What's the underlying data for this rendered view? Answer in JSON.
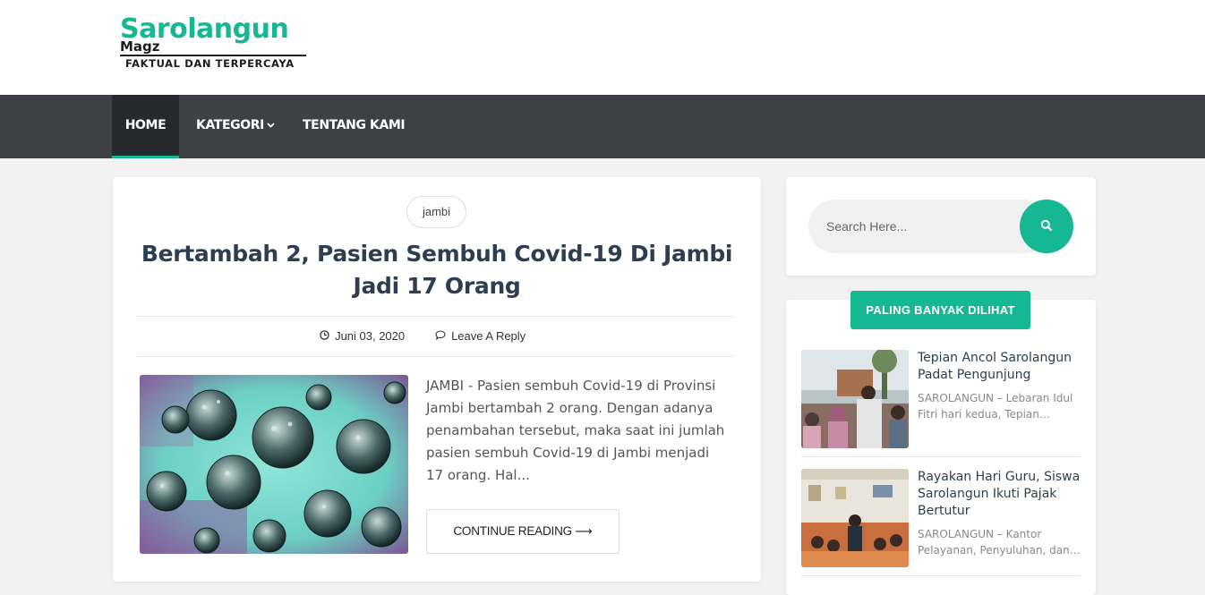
{
  "header": {
    "logo_main": "Sarolangun",
    "logo_sub": "Magz",
    "logo_tagline": "FAKTUAL DAN TERPERCAYA"
  },
  "nav": {
    "items": [
      {
        "label": "HOME",
        "active": true
      },
      {
        "label": "KATEGORI",
        "has_dropdown": true
      },
      {
        "label": "TENTANG KAMI"
      }
    ]
  },
  "post": {
    "category": "jambi",
    "title": "Bertambah 2, Pasien Sembuh Covid-19 Di Jambi Jadi 17 Orang",
    "date": "Juni 03, 2020",
    "reply": "Leave A Reply",
    "excerpt": "JAMBI - Pasien sembuh Covid-19 di Provinsi Jambi bertambah 2 orang. Dengan adanya penambahan tersebut, maka saat ini jumlah pasien sembuh Covid-19 di Jambi menjadi 17 orang. Hal...",
    "read_more": "CONTINUE READING ⟶",
    "thumbnail_icon": "virus-image"
  },
  "sidebar": {
    "search_placeholder": "Search Here...",
    "popular_heading": "PALING BANYAK DILIHAT",
    "popular": [
      {
        "title": "Tepian Ancol Sarolangun Padat Pengunjung",
        "excerpt": "SAROLANGUN – Lebaran Idul Fitri hari kedua, Tepian…"
      },
      {
        "title": "Rayakan Hari Guru, Siswa Sarolangun Ikuti Pajak Bertutur",
        "excerpt": "SAROLANGUN – Kantor Pelayanan, Penyuluhan, dan…"
      }
    ]
  },
  "colors": {
    "accent": "#16b894",
    "nav_bg": "#3d4146",
    "nav_active_bg": "#26292d",
    "title": "#2c3e50"
  }
}
